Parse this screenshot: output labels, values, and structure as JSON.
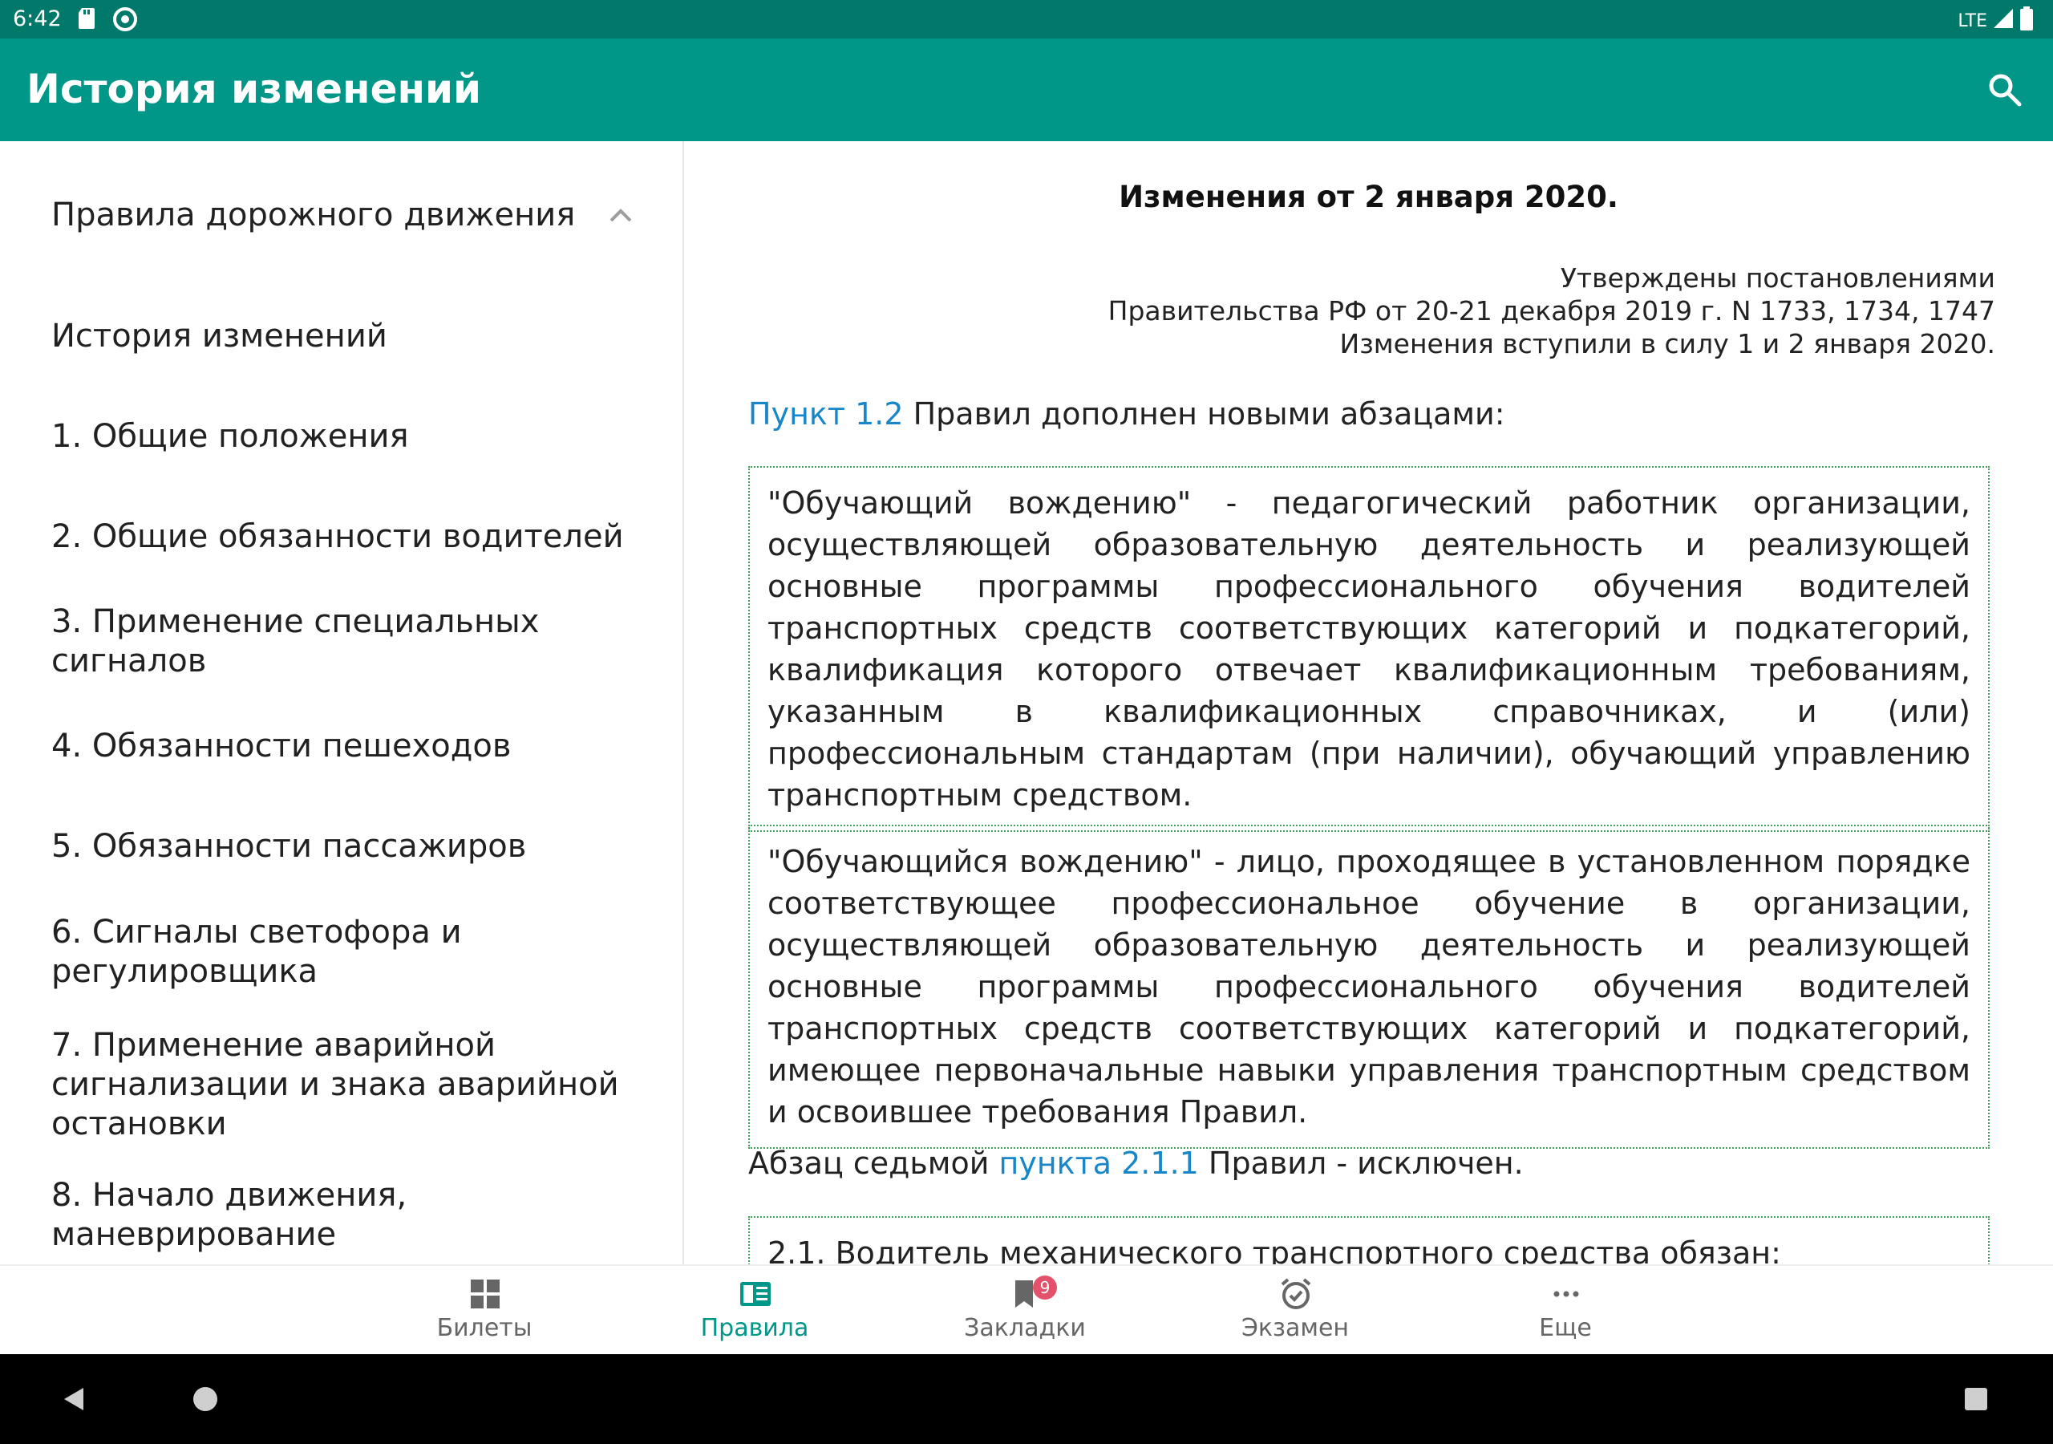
{
  "status_bar": {
    "time": "6:42",
    "network": "LTE"
  },
  "app_bar": {
    "title": "История изменений"
  },
  "sidebar": {
    "section": "Правила дорожного движения",
    "items": [
      "История изменений",
      "1. Общие положения",
      "2. Общие обязанности водителей",
      "3. Применение специальных сигналов",
      "4. Обязанности пешеходов",
      "5. Обязанности пассажиров",
      "6. Сигналы светофора и регулировщика",
      "7. Применение аварийной сигнализации и знака аварийной остановки",
      "8. Начало движения, маневрирование"
    ]
  },
  "content": {
    "heading": "Изменения от 2 января 2020.",
    "approved": {
      "line1": "Утверждены постановлениями",
      "line2": "Правительства РФ от 20-21 декабря 2019 г. N 1733, 1734, 1747",
      "line3": "Изменения вступили в силу 1 и 2 января 2020."
    },
    "p1": {
      "link": "Пункт 1.2",
      "text": " Правил дополнен новыми абзацами:"
    },
    "box1": "\"Обучающий вождению\" - педагогический работник организации, осуществляющей образовательную деятельность и реализующей основные программы профессионального обучения водителей транспортных средств соответствующих категорий и подкатегорий, квалификация которого отвечает квалификационным требованиям, указанным в квалификационных справочниках, и (или) профессиональным стандартам (при наличии), обучающий управлению транспортным средством.",
    "box2": "\"Обучающийся вождению\" - лицо, проходящее в установленном порядке соответствующее профессиональное обучение в организации, осуществляющей образовательную деятельность и реализующей основные программы профессионального обучения водителей транспортных средств соответствующих категорий и подкатегорий, имеющее первоначальные навыки управления транспортным средством и освоившее требования Правил.",
    "p2": {
      "before": "Абзац седьмой ",
      "link": "пункта 2.1.1",
      "after": " Правил - исключен."
    },
    "box3": "2.1. Водитель механического транспортного средства обязан:"
  },
  "bottom_nav": {
    "items": [
      {
        "label": "Билеты",
        "icon": "grid-icon"
      },
      {
        "label": "Правила",
        "icon": "book-icon"
      },
      {
        "label": "Закладки",
        "icon": "bookmark-icon",
        "badge": "9"
      },
      {
        "label": "Экзамен",
        "icon": "alarm-check-icon"
      },
      {
        "label": "Еще",
        "icon": "more-icon"
      }
    ]
  },
  "colors": {
    "primary": "#009688",
    "primary_dark": "#00796b",
    "link": "#1787c9",
    "badge": "#e3526a"
  }
}
